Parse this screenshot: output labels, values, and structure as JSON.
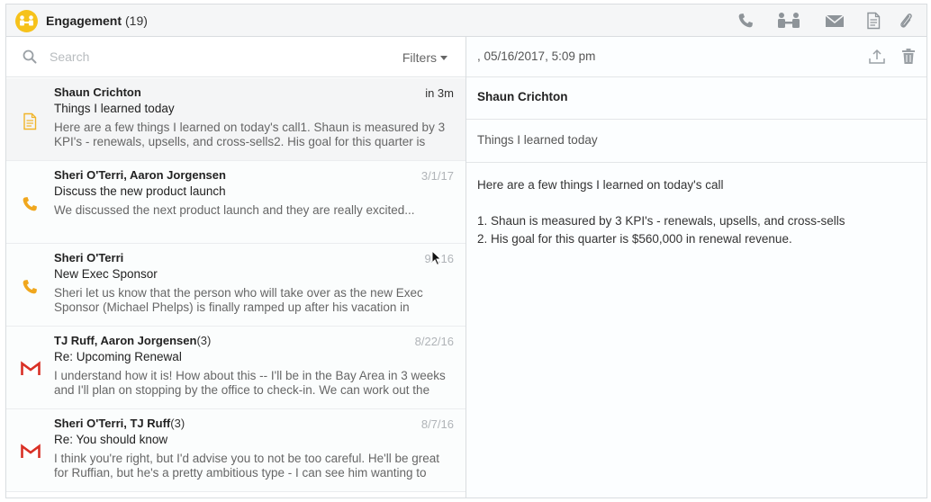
{
  "header": {
    "title": "Engagement",
    "count": "(19)",
    "icons": [
      "phone-icon",
      "meeting-icon",
      "email-icon",
      "note-icon",
      "attachment-icon"
    ],
    "accent_color": "#f6c21b"
  },
  "search": {
    "placeholder": "Search",
    "value": "",
    "filters_label": "Filters"
  },
  "items": [
    {
      "type": "note",
      "names": "Shaun Crichton",
      "count": "",
      "date": "in 3m",
      "subject": "Things I learned today",
      "preview": "Here are a few things I learned on today's call1. Shaun is measured by 3 KPI's - renewals, upsells, and cross-sells2. His goal for this quarter is"
    },
    {
      "type": "call",
      "names": "Sheri O'Terri, Aaron Jorgensen",
      "count": "",
      "date": "3/1/17",
      "subject": "Discuss the new product launch",
      "preview": "We discussed the next product launch and they are really excited..."
    },
    {
      "type": "call",
      "names": "Sheri O'Terri",
      "count": "",
      "date": "9/..16",
      "subject": "New Exec Sponsor",
      "preview": "Sheri let us know that the person who will take over as the new Exec Sponsor (Michael Phelps) is finally ramped up after his vacation in"
    },
    {
      "type": "gmail",
      "names": "TJ Ruff, Aaron Jorgensen",
      "count": "(3)",
      "date": "8/22/16",
      "subject": "Re: Upcoming Renewal",
      "preview": "I understand how it is! How about this -- I'll be in the Bay Area in 3 weeks and I'll plan on stopping by the office to check-in. We can work out the"
    },
    {
      "type": "gmail",
      "names": "Sheri O'Terri, TJ Ruff",
      "count": "(3)",
      "date": "8/7/16",
      "subject": "Re: You should know",
      "preview": "I think you're right, but I'd advise you to not be too careful. He'll be great for Ruffian, but he's a pretty ambitious type - I can see him wanting to"
    }
  ],
  "detail": {
    "date": ", 05/16/2017, 5:09 pm",
    "author": "Shaun Crichton",
    "subject": "Things I learned today",
    "body_lines": [
      "Here are a few things I learned on today's call",
      "",
      "1. Shaun is measured by 3 KPI's - renewals, upsells, and cross-sells",
      "2. His goal for this quarter is $560,000 in renewal revenue."
    ],
    "tools": [
      "upload-icon",
      "trash-icon"
    ]
  }
}
